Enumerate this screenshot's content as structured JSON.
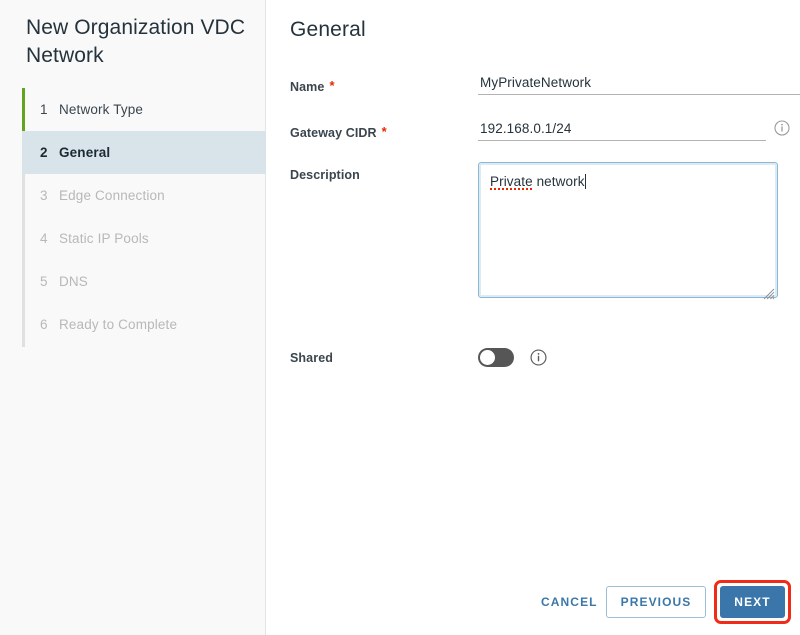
{
  "window": {
    "title": "New Organization VDC Network"
  },
  "sidebar": {
    "steps": [
      {
        "num": "1",
        "label": "Network Type",
        "state": "done"
      },
      {
        "num": "2",
        "label": "General",
        "state": "active"
      },
      {
        "num": "3",
        "label": "Edge Connection",
        "state": "upcoming"
      },
      {
        "num": "4",
        "label": "Static IP Pools",
        "state": "upcoming"
      },
      {
        "num": "5",
        "label": "DNS",
        "state": "upcoming"
      },
      {
        "num": "6",
        "label": "Ready to Complete",
        "state": "upcoming"
      }
    ]
  },
  "main": {
    "heading": "General",
    "fields": {
      "name": {
        "label": "Name",
        "required_marker": "*",
        "value": "MyPrivateNetwork",
        "placeholder": ""
      },
      "gateway_cidr": {
        "label": "Gateway CIDR",
        "required_marker": "*",
        "value": "192.168.0.1/24",
        "placeholder": "",
        "info_icon": "info-circle-icon"
      },
      "description": {
        "label": "Description",
        "value": "Private network",
        "misspelled_word": "Private",
        "rest_text": " network",
        "placeholder": ""
      },
      "shared": {
        "label": "Shared",
        "state": "off",
        "info_icon": "info-circle-icon"
      }
    }
  },
  "footer": {
    "cancel_label": "CANCEL",
    "previous_label": "PREVIOUS",
    "next_label": "NEXT"
  },
  "annotation": {
    "highlight_target": "next-button",
    "highlight_color": "#f02b17"
  },
  "colors": {
    "accent_blue": "#3a76aa",
    "link_blue": "#3b77a8",
    "completed_green": "#62a420",
    "active_step_bg": "#d9e4ea",
    "required_red": "#e62700",
    "sidebar_bg": "#f9f9f9",
    "text_dark": "#25333d",
    "text_muted": "#b8b8b8"
  }
}
